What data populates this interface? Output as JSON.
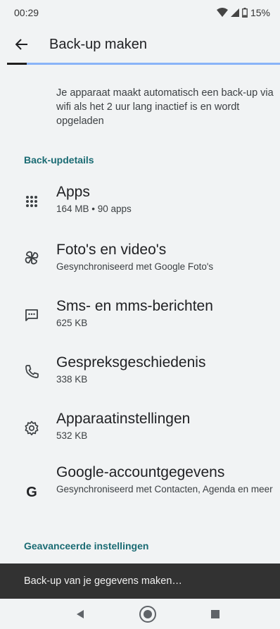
{
  "status": {
    "time": "00:29",
    "battery": "15%"
  },
  "app_bar": {
    "title": "Back-up maken"
  },
  "description": "Je apparaat maakt automatisch een back-up via wifi als het 2 uur lang inactief is en wordt opgeladen",
  "backup_details": {
    "header": "Back-updetails",
    "items": [
      {
        "title": "Apps",
        "subtitle": "164 MB • 90 apps",
        "icon": "apps-grid-icon"
      },
      {
        "title": "Foto's en video's",
        "subtitle": "Gesynchroniseerd met Google Foto's",
        "icon": "pinwheel-icon"
      },
      {
        "title": "Sms- en mms-berichten",
        "subtitle": "625 KB",
        "icon": "message-icon"
      },
      {
        "title": "Gespreksgeschiedenis",
        "subtitle": "338 KB",
        "icon": "phone-icon"
      },
      {
        "title": "Apparaatinstellingen",
        "subtitle": "532 KB",
        "icon": "gear-icon"
      },
      {
        "title": "Google-accountgegevens",
        "subtitle": "Gesynchroniseerd met Contacten, Agenda en meer",
        "icon": "google-g-icon"
      }
    ]
  },
  "advanced": {
    "header": "Geavanceerde instellingen"
  },
  "snackbar": {
    "text": "Back-up van je gegevens maken…"
  },
  "colors": {
    "accent": "#1a6b73",
    "progress": "#8ab4f8",
    "snackbar": "#323232",
    "background": "#f1f3f4"
  }
}
